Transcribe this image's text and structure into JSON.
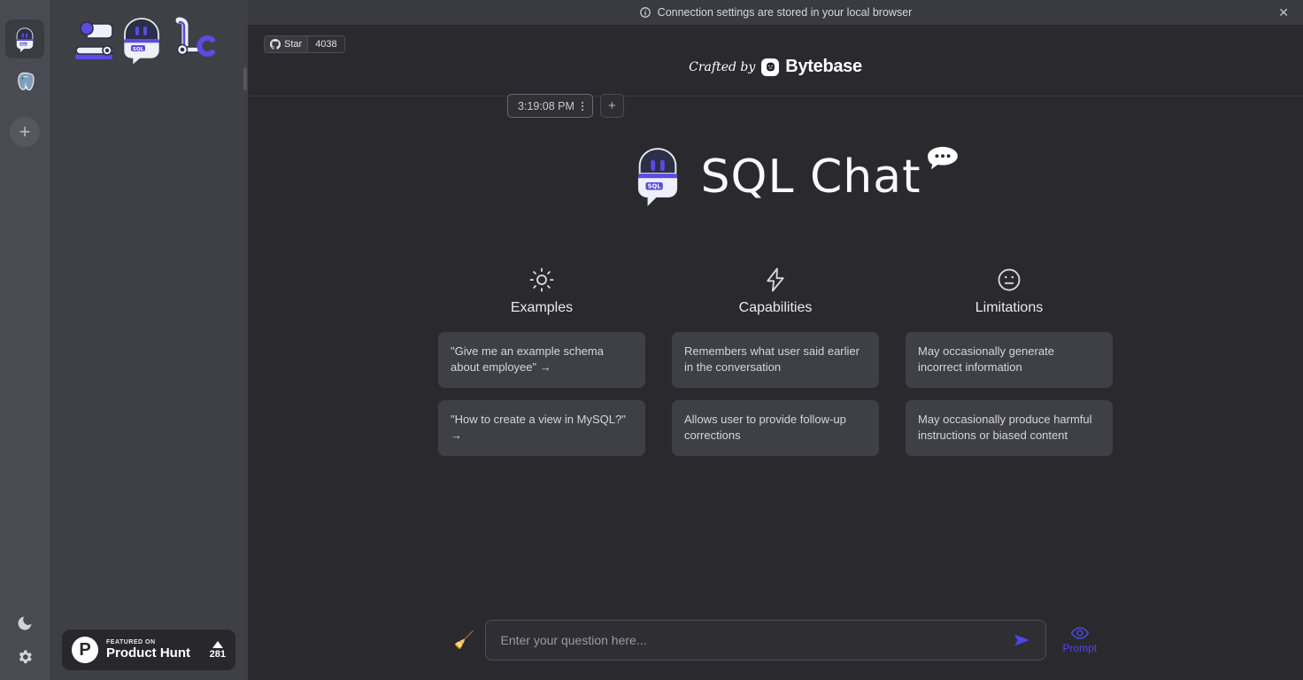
{
  "banner": {
    "message": "Connection settings are stored in your local browser",
    "info_icon": "info-circle-icon",
    "close_icon": "close-icon"
  },
  "rail": {
    "items": [
      {
        "name": "sql-chat-robot",
        "icon": "robot-icon",
        "selected": true
      },
      {
        "name": "postgres-connection",
        "icon": "postgresql-elephant-icon",
        "selected": false
      }
    ],
    "add_label": "+",
    "bottom": [
      {
        "name": "dark-mode-toggle",
        "icon": "moon-icon"
      },
      {
        "name": "settings",
        "icon": "gear-icon"
      }
    ]
  },
  "sidebar": {
    "logo_alt": "SQL Chat",
    "conversations": [],
    "product_hunt": {
      "kicker": "FEATURED ON",
      "name": "Product Hunt",
      "count": "281",
      "logo_letter": "P"
    }
  },
  "topbar": {
    "star": {
      "label": "Star",
      "count": "4038",
      "icon": "github-icon"
    },
    "crafted": {
      "prefix": "Crafted by",
      "brand": "Bytebase"
    },
    "tabs": [
      {
        "label": "3:19:08 PM",
        "menu_icon": "vertical-dots-icon",
        "active": true
      }
    ],
    "add_tab_label": "+"
  },
  "hero": {
    "title": "SQL Chat",
    "logo_alt": "SQL Chat robot",
    "bubble_icon": "chat-bubble-icon"
  },
  "columns": [
    {
      "icon": "sun-icon",
      "title": "Examples",
      "cards": [
        "\"Give me an example schema about employee\" →",
        "\"How to create a view in MySQL?\" →"
      ]
    },
    {
      "icon": "lightning-bolt-icon",
      "title": "Capabilities",
      "cards": [
        "Remembers what user said earlier in the conversation",
        "Allows user to provide follow-up corrections"
      ]
    },
    {
      "icon": "neutral-face-icon",
      "title": "Limitations",
      "cards": [
        "May occasionally generate incorrect information",
        "May occasionally produce harmful instructions or biased content"
      ]
    }
  ],
  "composer": {
    "clear_icon": "broom-icon",
    "placeholder": "Enter your question here...",
    "value": "",
    "send_icon": "send-arrow-icon",
    "prompt_label": "Prompt",
    "prompt_icon": "eye-icon"
  },
  "colors": {
    "accent": "#4f46e5",
    "page_bg": "#2a2a2e",
    "sidebar_bg": "#3f4045",
    "rail_bg": "#4a4a52",
    "card_bg": "#3f3f46"
  }
}
